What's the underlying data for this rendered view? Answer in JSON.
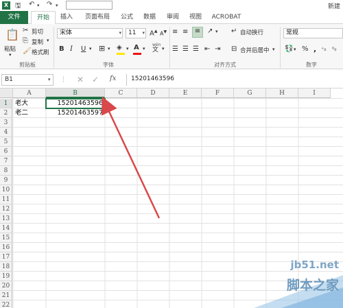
{
  "titlebar": {
    "doc_title": "新建"
  },
  "tabs": [
    "文件",
    "开始",
    "插入",
    "页面布局",
    "公式",
    "数据",
    "审阅",
    "视图",
    "ACROBAT"
  ],
  "ribbon": {
    "clipboard": {
      "paste": "粘贴",
      "cut": "剪切",
      "copy": "复制",
      "format_painter": "格式刷",
      "group_label": "剪贴板"
    },
    "font": {
      "name": "宋体",
      "size": "11",
      "bold": "B",
      "italic": "I",
      "underline": "U",
      "grow": "A",
      "shrink": "A",
      "group_label": "字体",
      "wen": "wén"
    },
    "alignment": {
      "wrap": "自动换行",
      "merge": "合并后居中",
      "group_label": "对齐方式"
    },
    "number": {
      "format": "常规",
      "percent": "%",
      "comma": ",",
      "group_label": "数字"
    }
  },
  "formula_bar": {
    "name_box": "B1",
    "fx": "fx",
    "value": "15201463596"
  },
  "columns": [
    "A",
    "B",
    "C",
    "D",
    "E",
    "F",
    "G",
    "H",
    "I"
  ],
  "rows": [
    "1",
    "2",
    "3",
    "4",
    "5",
    "6",
    "7",
    "8",
    "9",
    "10",
    "11",
    "12",
    "13",
    "14",
    "15",
    "16",
    "17",
    "18",
    "19",
    "20",
    "21",
    "22"
  ],
  "cells": {
    "A1": "老大",
    "B1": "15201463596",
    "A2": "老二",
    "B2": "15201463597"
  },
  "watermark": {
    "site": "jb51.net",
    "text": "脚本之家"
  },
  "colors": {
    "accent": "#217346",
    "arrow": "#d9484a"
  }
}
